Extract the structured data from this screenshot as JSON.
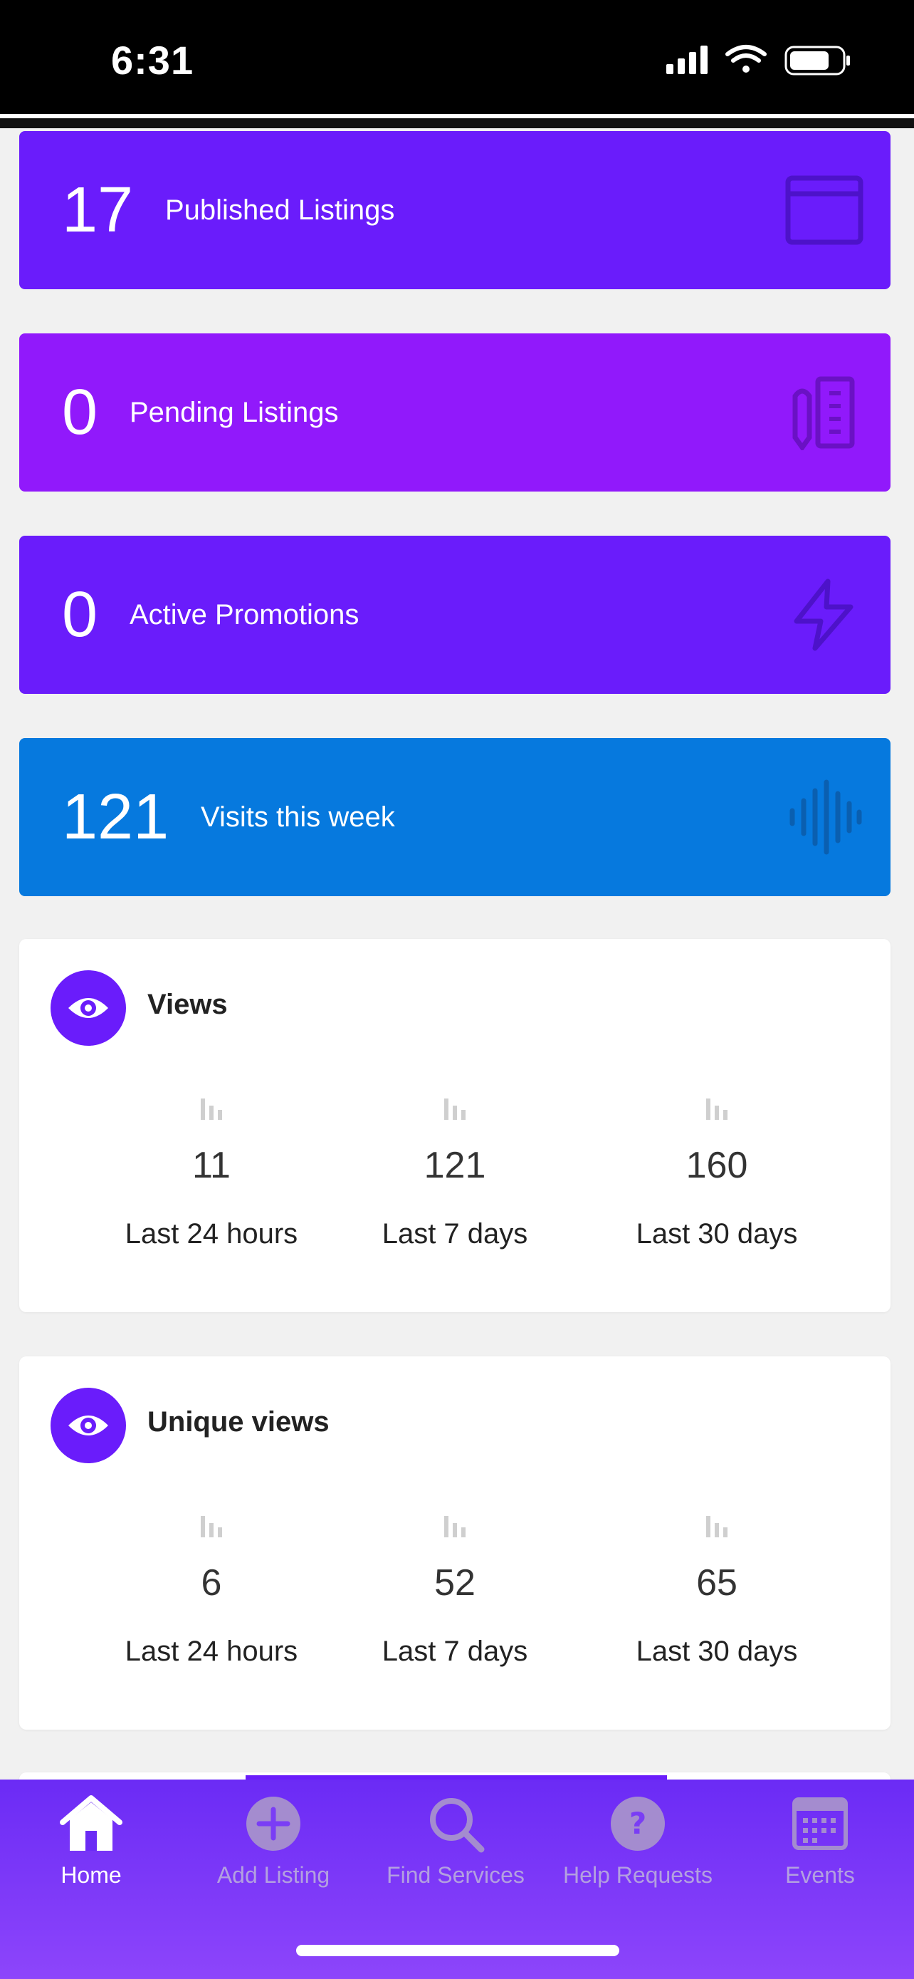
{
  "status_bar": {
    "time": "6:31"
  },
  "stats": [
    {
      "number": "17",
      "label": "Published Listings",
      "icon": "browser-window-icon",
      "color": "#6a1cfb"
    },
    {
      "number": "0",
      "label": "Pending Listings",
      "icon": "pencil-ruler-icon",
      "color": "#9119fb"
    },
    {
      "number": "0",
      "label": "Active Promotions",
      "icon": "lightning-icon",
      "color": "#6a1cfb"
    },
    {
      "number": "121",
      "label": "Visits this week",
      "icon": "sound-wave-icon",
      "color": "#0679de"
    }
  ],
  "views_panel": {
    "title": "Views",
    "columns": [
      {
        "value": "11",
        "period": "Last 24 hours"
      },
      {
        "value": "121",
        "period": "Last 7 days"
      },
      {
        "value": "160",
        "period": "Last 30 days"
      }
    ]
  },
  "unique_views_panel": {
    "title": "Unique views",
    "columns": [
      {
        "value": "6",
        "period": "Last 24 hours"
      },
      {
        "value": "52",
        "period": "Last 7 days"
      },
      {
        "value": "65",
        "period": "Last 30 days"
      }
    ]
  },
  "tab_bar": {
    "tabs": [
      {
        "label": "Home",
        "icon": "home-icon",
        "active": true
      },
      {
        "label": "Add Listing",
        "icon": "plus-circle-icon",
        "active": false
      },
      {
        "label": "Find Services",
        "icon": "search-icon",
        "active": false
      },
      {
        "label": "Help Requests",
        "icon": "question-circle-icon",
        "active": false
      },
      {
        "label": "Events",
        "icon": "calendar-icon",
        "active": false
      }
    ]
  },
  "colors": {
    "accent": "#6a1cfb",
    "pending": "#9119fb",
    "visits": "#0679de"
  }
}
